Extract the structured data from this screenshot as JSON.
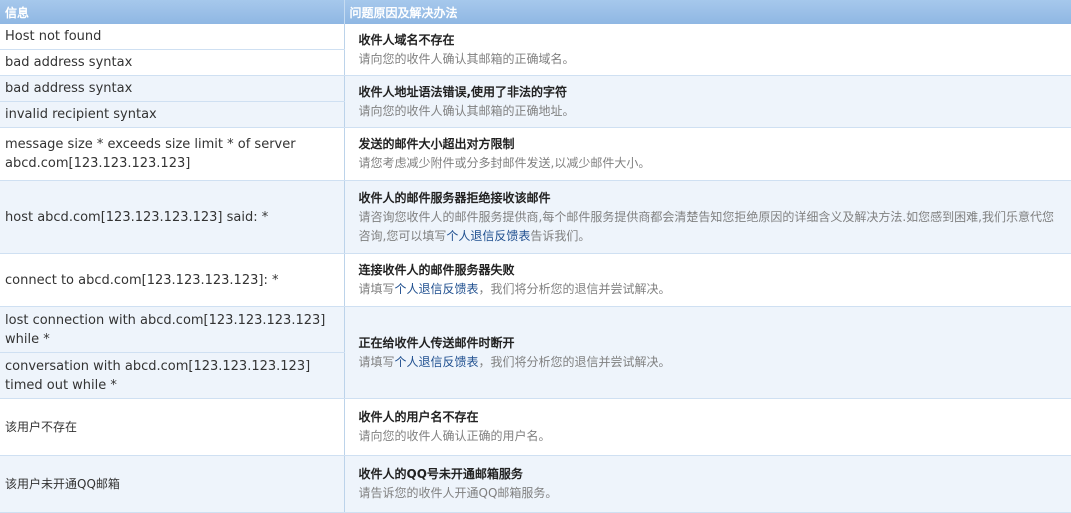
{
  "header": {
    "col_info": "信息",
    "col_solution": "问题原因及解决办法"
  },
  "groups": [
    {
      "infos": [
        "Host not found",
        "bad address syntax"
      ],
      "title": "收件人域名不存在",
      "desc_before": "请向您的收件人确认其邮箱的正确域名。",
      "link": "",
      "desc_after": ""
    },
    {
      "infos": [
        "bad address syntax",
        "invalid recipient syntax"
      ],
      "title": "收件人地址语法错误,使用了非法的字符",
      "desc_before": "请向您的收件人确认其邮箱的正确地址。",
      "link": "",
      "desc_after": ""
    },
    {
      "infos": [
        "message size * exceeds size limit * of server abcd.com[123.123.123.123]"
      ],
      "title": "发送的邮件大小超出对方限制",
      "desc_before": "请您考虑减少附件或分多封邮件发送,以减少邮件大小。",
      "link": "",
      "desc_after": ""
    },
    {
      "infos": [
        "host abcd.com[123.123.123.123] said: *"
      ],
      "title": "收件人的邮件服务器拒绝接收该邮件",
      "desc_before": "请咨询您收件人的邮件服务提供商,每个邮件服务提供商都会清楚告知您拒绝原因的详细含义及解决方法.如您感到困难,我们乐意代您咨询,您可以填写",
      "link": "个人退信反馈表",
      "desc_after": "告诉我们。"
    },
    {
      "infos": [
        "connect to abcd.com[123.123.123.123]: *"
      ],
      "title": "连接收件人的邮件服务器失败",
      "desc_before": "请填写",
      "link": "个人退信反馈表",
      "desc_after": "，我们将分析您的退信并尝试解决。"
    },
    {
      "infos": [
        "lost connection with abcd.com[123.123.123.123] while *",
        "conversation with abcd.com[123.123.123.123] timed out while *"
      ],
      "title": "正在给收件人传送邮件时断开",
      "desc_before": "请填写",
      "link": "个人退信反馈表",
      "desc_after": "，我们将分析您的退信并尝试解决。"
    },
    {
      "infos": [
        "该用户不存在"
      ],
      "title": "收件人的用户名不存在",
      "desc_before": "请向您的收件人确认正确的用户名。",
      "link": "",
      "desc_after": ""
    },
    {
      "infos": [
        "该用户未开通QQ邮箱"
      ],
      "title": "收件人的QQ号未开通邮箱服务",
      "desc_before": "请告诉您的收件人开通QQ邮箱服务。",
      "link": "",
      "desc_after": ""
    }
  ]
}
